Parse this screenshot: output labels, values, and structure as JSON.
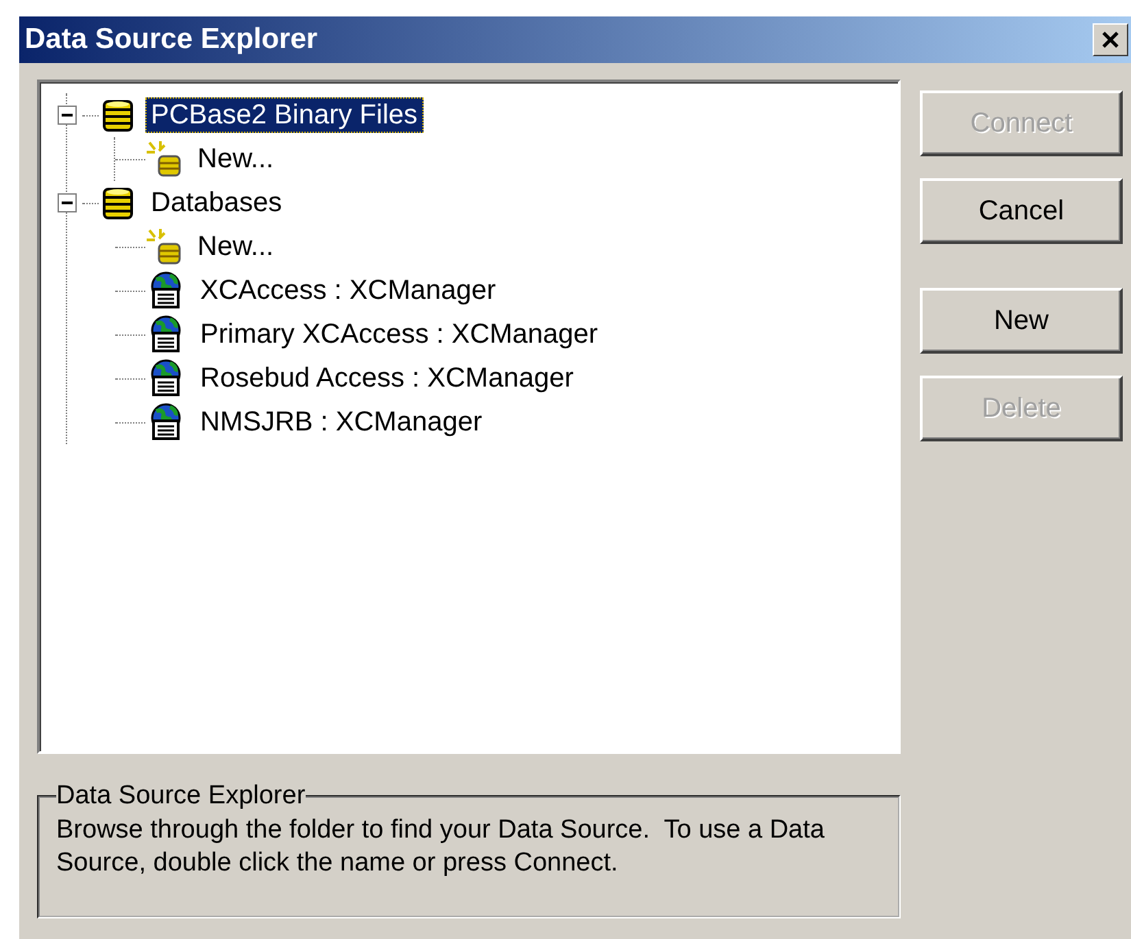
{
  "window": {
    "title": "Data Source Explorer"
  },
  "tree": [
    {
      "label": "PCBase2 Binary Files",
      "kind": "database",
      "expanded": true,
      "selected": true,
      "children": [
        {
          "label": "New...",
          "kind": "new",
          "selected": false
        }
      ]
    },
    {
      "label": "Databases",
      "kind": "database",
      "expanded": true,
      "selected": false,
      "children": [
        {
          "label": "New...",
          "kind": "new",
          "selected": false
        },
        {
          "label": "XCAccess : XCManager",
          "kind": "server",
          "selected": false
        },
        {
          "label": "Primary XCAccess : XCManager",
          "kind": "server",
          "selected": false
        },
        {
          "label": "Rosebud Access : XCManager",
          "kind": "server",
          "selected": false
        },
        {
          "label": "NMSJRB : XCManager",
          "kind": "server",
          "selected": false
        }
      ]
    }
  ],
  "buttons": [
    {
      "label": "Connect",
      "disabled": true
    },
    {
      "label": "Cancel",
      "disabled": false
    },
    {
      "label": "New",
      "disabled": false
    },
    {
      "label": "Delete",
      "disabled": true
    }
  ],
  "info": {
    "title": "Data Source Explorer",
    "text": "Browse through the folder to find your Data Source.  To use a Data Source, double click the name or press Connect."
  }
}
